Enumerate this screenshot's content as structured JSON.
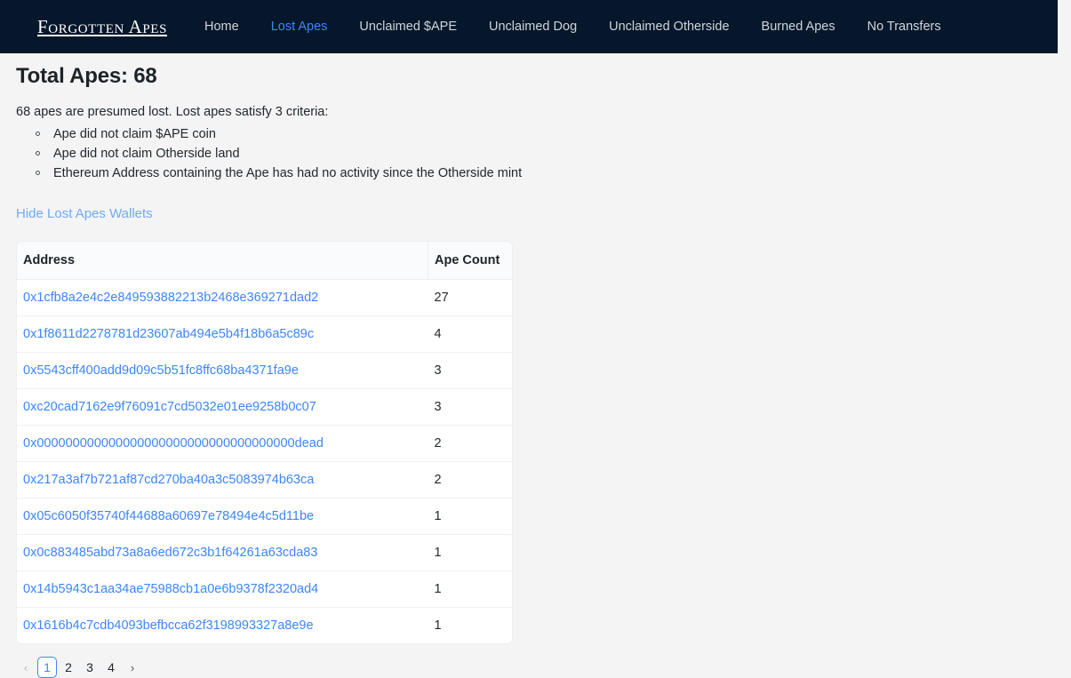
{
  "navbar": {
    "brand": "Forgotten Apes",
    "links": [
      {
        "label": "Home",
        "active": false
      },
      {
        "label": "Lost Apes",
        "active": true
      },
      {
        "label": "Unclaimed $APE",
        "active": false
      },
      {
        "label": "Unclaimed Dog",
        "active": false
      },
      {
        "label": "Unclaimed Otherside",
        "active": false
      },
      {
        "label": "Burned Apes",
        "active": false
      },
      {
        "label": "No Transfers",
        "active": false
      }
    ],
    "background_color": "#06172b",
    "link_color": "#cfd4da",
    "active_link_color": "#3d86f7"
  },
  "main": {
    "title": "Total Apes: 68",
    "summary": "68 apes are presumed lost. Lost apes satisfy 3 criteria:",
    "criteria": [
      "Ape did not claim $APE coin",
      "Ape did not claim Otherside land",
      "Ethereum Address containing the Ape has had no activity since the Otherside mint"
    ],
    "toggle_label": "Hide Lost Apes Wallets",
    "toggle_color": "#73a9f5"
  },
  "table": {
    "columns": [
      "Address",
      "Ape Count"
    ],
    "rows": [
      {
        "address": "0x1cfb8a2e4c2e849593882213b2468e369271dad2",
        "count": "27"
      },
      {
        "address": "0x1f8611d2278781d23607ab494e5b4f18b6a5c89c",
        "count": "4"
      },
      {
        "address": "0x5543cff400add9d09c5b51fc8ffc68ba4371fa9e",
        "count": "3"
      },
      {
        "address": "0xc20cad7162e9f76091c7cd5032e01ee9258b0c07",
        "count": "3"
      },
      {
        "address": "0x000000000000000000000000000000000000dead",
        "count": "2"
      },
      {
        "address": "0x217a3af7b721af87cd270ba40a3c5083974b63ca",
        "count": "2"
      },
      {
        "address": "0x05c6050f35740f44688a60697e78494e4c5d11be",
        "count": "1"
      },
      {
        "address": "0x0c883485abd73a8a6ed672c3b1f64261a63cda83",
        "count": "1"
      },
      {
        "address": "0x14b5943c1aa34ae75988cb1a0e6b9378f2320ad4",
        "count": "1"
      },
      {
        "address": "0x1616b4c7cdb4093befbcca62f3198993327a8e9e",
        "count": "1"
      }
    ],
    "link_color": "#3d86f7"
  },
  "pagination": {
    "prev_icon": "‹",
    "next_icon": "›",
    "pages": [
      "1",
      "2",
      "3",
      "4"
    ],
    "current_page": "1",
    "prev_disabled": true,
    "next_disabled": false
  }
}
